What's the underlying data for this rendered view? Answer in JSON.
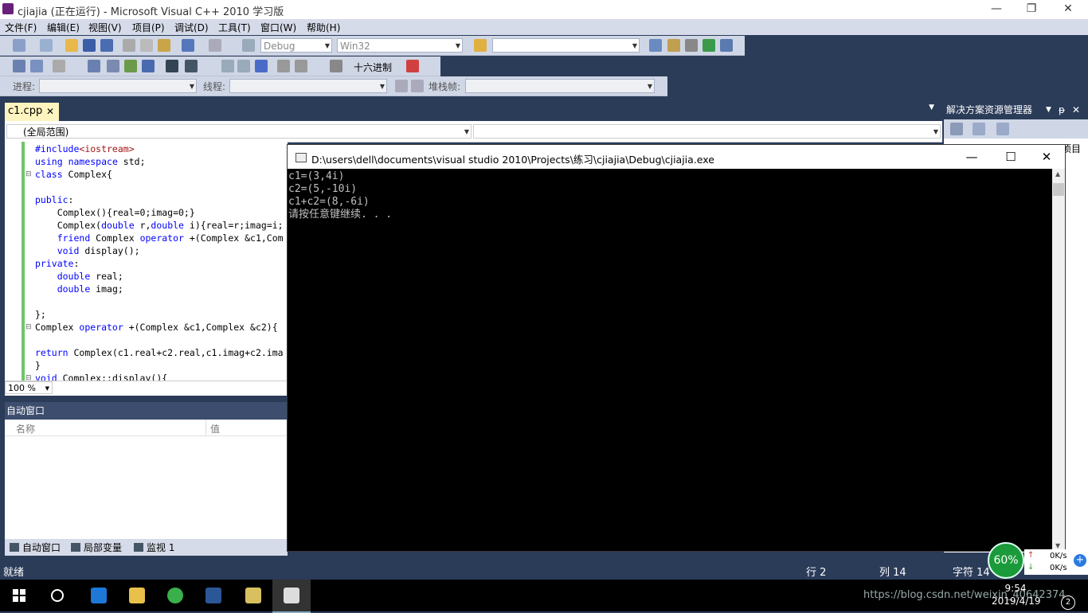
{
  "window": {
    "title": "cjiajia (正在运行) - Microsoft Visual C++ 2010 学习版",
    "min": "—",
    "max": "❐",
    "close": "✕"
  },
  "menu": [
    "文件(F)",
    "编辑(E)",
    "视图(V)",
    "项目(P)",
    "调试(D)",
    "工具(T)",
    "窗口(W)",
    "帮助(H)"
  ],
  "toolbar": {
    "config": "Debug",
    "platform": "Win32",
    "hex_label": "十六进制",
    "process_label": "进程:",
    "thread_label": "线程:",
    "stack_label": "堆栈帧:"
  },
  "editor": {
    "tab": "c1.cpp",
    "tab_close": "✕",
    "scope": "(全局范围)",
    "zoom": "100 %",
    "lines": [
      [
        [
          "#include",
          "kw"
        ],
        [
          "<iostream>",
          "str"
        ]
      ],
      [
        [
          "using",
          "kw"
        ],
        [
          " "
        ],
        [
          "namespace",
          "kw"
        ],
        [
          " std;"
        ]
      ],
      [
        [
          "class",
          "kw"
        ],
        [
          " Complex{"
        ]
      ],
      [
        [
          ""
        ]
      ],
      [
        [
          "public",
          "kw"
        ],
        [
          ":"
        ]
      ],
      [
        [
          "    Complex(){real=0;imag=0;}"
        ]
      ],
      [
        [
          "    Complex("
        ],
        [
          "double",
          "kw"
        ],
        [
          " r,"
        ],
        [
          "double",
          "kw"
        ],
        [
          " i){real=r;imag=i;"
        ]
      ],
      [
        [
          "    "
        ],
        [
          "friend",
          "kw"
        ],
        [
          " Complex "
        ],
        [
          "operator",
          "kw"
        ],
        [
          " +(Complex &c1,Com"
        ]
      ],
      [
        [
          "    "
        ],
        [
          "void",
          "kw"
        ],
        [
          " display();"
        ]
      ],
      [
        [
          "private",
          "kw"
        ],
        [
          ":"
        ]
      ],
      [
        [
          "    "
        ],
        [
          "double",
          "kw"
        ],
        [
          " real;"
        ]
      ],
      [
        [
          "    "
        ],
        [
          "double",
          "kw"
        ],
        [
          " imag;"
        ]
      ],
      [
        [
          ""
        ]
      ],
      [
        [
          "};"
        ]
      ],
      [
        [
          "Complex "
        ],
        [
          "operator",
          "kw"
        ],
        [
          " +(Complex &c1,Complex &c2){"
        ]
      ],
      [
        [
          ""
        ]
      ],
      [
        [
          "return",
          "kw"
        ],
        [
          " Complex(c1.real+c2.real,c1.imag+c2.ima"
        ]
      ],
      [
        [
          "}"
        ]
      ],
      [
        [
          "void",
          "kw"
        ],
        [
          " Complex::display(){"
        ]
      ]
    ]
  },
  "autowin": {
    "title": "自动窗口",
    "col_name": "名称",
    "col_value": "值",
    "tabs": [
      "自动窗口",
      "局部变量",
      "监视 1"
    ]
  },
  "solution": {
    "title": "解决方案资源管理器",
    "item_tail": "项目"
  },
  "console": {
    "title": "D:\\users\\dell\\documents\\visual studio 2010\\Projects\\练习\\cjiajia\\Debug\\cjiajia.exe",
    "output": "c1=(3,4i)\nc2=(5,-10i)\nc1+c2=(8,-6i)\n请按任意键继续. . .",
    "min": "—",
    "max": "☐",
    "close": "✕"
  },
  "status": {
    "ready": "就绪",
    "row": "行 2",
    "col": "列 14",
    "char": "字符 14",
    "cpu": "60%",
    "up": "0K/s",
    "down": "0K/s"
  },
  "taskbar": {
    "time": "9:54",
    "date": "2019/4/19",
    "watermark": "https://blog.csdn.net/weixin_40642374",
    "notif_count": "2"
  }
}
